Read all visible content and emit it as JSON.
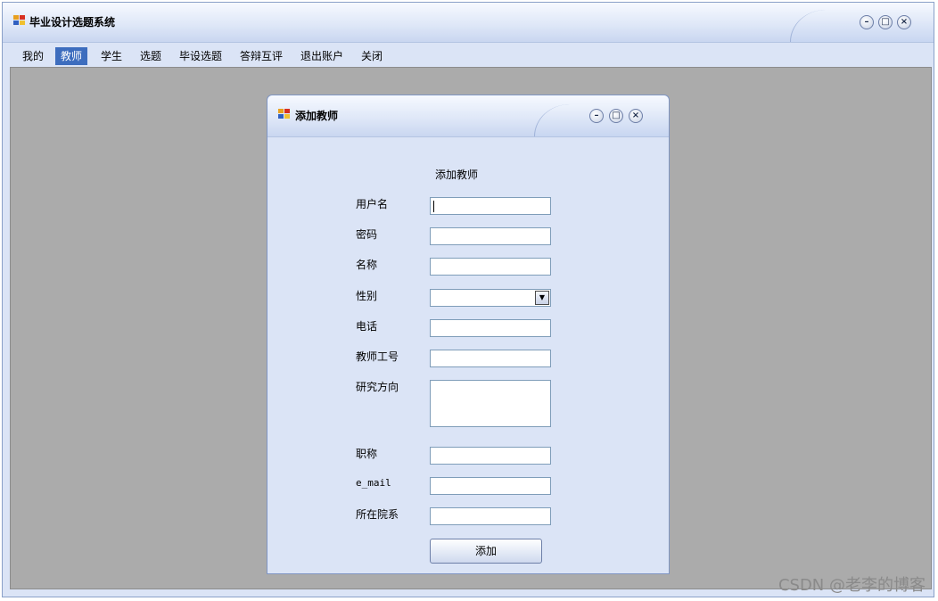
{
  "app": {
    "title": "毕业设计选题系统"
  },
  "window_controls": {
    "minimize_glyph": "–",
    "maximize_glyph": "□",
    "close_glyph": "×"
  },
  "menu": [
    {
      "label": "我的"
    },
    {
      "label": "教师",
      "active": true
    },
    {
      "label": "学生"
    },
    {
      "label": "选题"
    },
    {
      "label": "毕设选题"
    },
    {
      "label": "答辩互评"
    },
    {
      "label": "退出账户"
    },
    {
      "label": "关闭"
    }
  ],
  "dialog": {
    "title": "添加教师",
    "heading": "添加教师",
    "fields": {
      "username": {
        "label": "用户名",
        "value": ""
      },
      "password": {
        "label": "密码",
        "value": ""
      },
      "name": {
        "label": "名称",
        "value": ""
      },
      "gender": {
        "label": "性别",
        "value": ""
      },
      "phone": {
        "label": "电话",
        "value": ""
      },
      "teacher_id": {
        "label": "教师工号",
        "value": ""
      },
      "research": {
        "label": "研究方向",
        "value": ""
      },
      "title": {
        "label": "职称",
        "value": ""
      },
      "email": {
        "label": "e_mail",
        "value": ""
      },
      "department": {
        "label": "所在院系",
        "value": ""
      }
    },
    "submit_label": "添加"
  },
  "watermark": "CSDN @老李的博客",
  "colors": {
    "menu_active": "#3d6dbe",
    "mdi_background": "#ababab",
    "form_background": "#dbe4f6"
  }
}
